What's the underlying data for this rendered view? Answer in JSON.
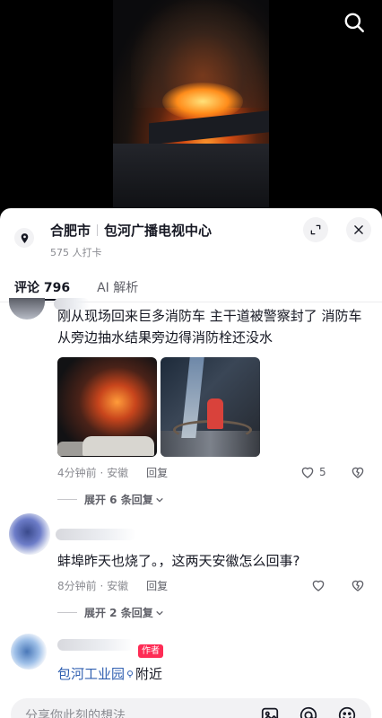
{
  "location": {
    "city": "合肥市",
    "place": "包河广播电视中心",
    "checkins": "575 人打卡"
  },
  "tabs": {
    "comments": "评论 796",
    "ai": "AI 解析"
  },
  "comments": [
    {
      "text": "刚从现场回来巨多消防车 主干道被警察封了 消防车从旁边抽水结果旁边得消防栓还没水",
      "time_loc": "4分钟前 · 安徽",
      "reply": "回复",
      "likes": "5",
      "expand": "展开 6 条回复"
    },
    {
      "text": "蚌埠昨天也烧了。，这两天安徽怎么回事?",
      "time_loc": "8分钟前 · 安徽",
      "reply": "回复",
      "expand": "展开 2 条回复"
    },
    {
      "badge": "作者",
      "place": "包河工业园",
      "nearby": "附近"
    }
  ],
  "input": {
    "placeholder": "分享你此刻的想法"
  },
  "icons": [
    "search-icon",
    "location-pin-icon",
    "expand-icon",
    "close-icon",
    "heart-icon",
    "broken-heart-icon",
    "chevron-down-icon",
    "image-icon",
    "at-icon",
    "emoji-icon"
  ],
  "colors": {
    "accent": "#fe2c55",
    "link": "#2f5fb0",
    "text": "#161823",
    "muted": "#8a8b91"
  }
}
